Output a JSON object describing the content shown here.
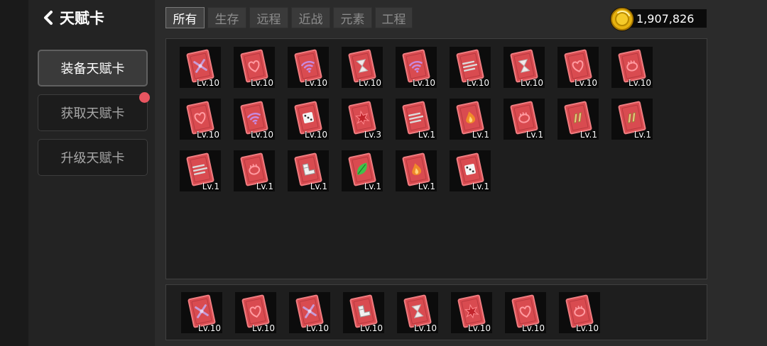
{
  "header": {
    "title": "天赋卡"
  },
  "sidebar": {
    "items": [
      {
        "label": "装备天赋卡",
        "active": true
      },
      {
        "label": "获取天赋卡",
        "active": false,
        "notification": true
      },
      {
        "label": "升级天赋卡",
        "active": false
      }
    ]
  },
  "tabs": [
    {
      "label": "所有",
      "active": true
    },
    {
      "label": "生存",
      "active": false
    },
    {
      "label": "远程",
      "active": false
    },
    {
      "label": "近战",
      "active": false
    },
    {
      "label": "元素",
      "active": false
    },
    {
      "label": "工程",
      "active": false
    }
  ],
  "currency": {
    "amount": "1,907,826",
    "icon": "gold-coin-icon"
  },
  "colors": {
    "card": "#d94b50",
    "card_border": "#f07c80",
    "accent_dot": "#e85560",
    "background": "#2b2b2b"
  },
  "cards": [
    {
      "level": "Lv.10",
      "icon": "swords-icon"
    },
    {
      "level": "Lv.10",
      "icon": "heart-shield-icon"
    },
    {
      "level": "Lv.10",
      "icon": "wifi-signal-icon"
    },
    {
      "level": "Lv.10",
      "icon": "hourglass-icon"
    },
    {
      "level": "Lv.10",
      "icon": "wifi-signal-icon"
    },
    {
      "level": "Lv.10",
      "icon": "wind-icon"
    },
    {
      "level": "Lv.10",
      "icon": "hourglass-icon"
    },
    {
      "level": "Lv.10",
      "icon": "heart-shield-icon"
    },
    {
      "level": "Lv.10",
      "icon": "fist-icon"
    },
    {
      "level": "Lv.10",
      "icon": "heart-shield-icon"
    },
    {
      "level": "Lv.10",
      "icon": "wifi-signal-icon"
    },
    {
      "level": "Lv.10",
      "icon": "dice-icon"
    },
    {
      "level": "Lv.3",
      "icon": "star-burst-icon"
    },
    {
      "level": "Lv.1",
      "icon": "wind-icon"
    },
    {
      "level": "Lv.1",
      "icon": "flame-icon"
    },
    {
      "level": "Lv.1",
      "icon": "fist-icon"
    },
    {
      "level": "Lv.1",
      "icon": "bullets-icon"
    },
    {
      "level": "Lv.1",
      "icon": "bullets-icon"
    },
    {
      "level": "Lv.1",
      "icon": "wind-icon"
    },
    {
      "level": "Lv.1",
      "icon": "fist-icon"
    },
    {
      "level": "Lv.1",
      "icon": "boot-icon"
    },
    {
      "level": "Lv.1",
      "icon": "leaf-icon"
    },
    {
      "level": "Lv.1",
      "icon": "flame-icon"
    },
    {
      "level": "Lv.1",
      "icon": "dice-icon"
    }
  ],
  "equipped": [
    {
      "level": "Lv.10",
      "icon": "swords-icon"
    },
    {
      "level": "Lv.10",
      "icon": "heart-shield-icon"
    },
    {
      "level": "Lv.10",
      "icon": "swords-icon"
    },
    {
      "level": "Lv.10",
      "icon": "boot-icon"
    },
    {
      "level": "Lv.10",
      "icon": "hourglass-icon"
    },
    {
      "level": "Lv.10",
      "icon": "star-burst-icon"
    },
    {
      "level": "Lv.10",
      "icon": "heart-shield-icon"
    },
    {
      "level": "Lv.10",
      "icon": "fist-icon"
    }
  ]
}
